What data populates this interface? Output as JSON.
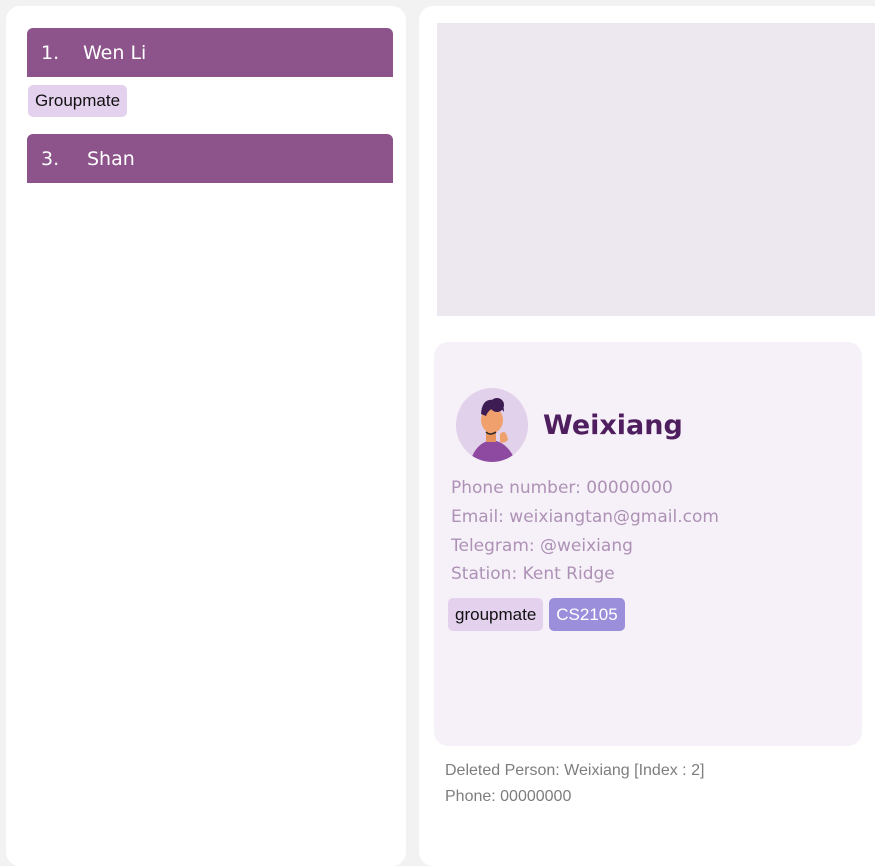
{
  "person_list": {
    "items": [
      {
        "index": "1.",
        "name": "Wen Li",
        "tag": "Groupmate"
      },
      {
        "index": "3.",
        "name": "Shan"
      }
    ]
  },
  "detail": {
    "name": "Weixiang",
    "phone": "Phone number: 00000000",
    "email": "Email: weixiangtan@gmail.com",
    "telegram": "Telegram: @weixiang",
    "station": "Station: Kent Ridge",
    "tags": [
      "groupmate",
      "CS2105"
    ],
    "avatar_icon": "avatar-person-icon"
  },
  "result": {
    "line1": "Deleted Person: Weixiang [Index : 2]",
    "line2": "Phone: 00000000"
  },
  "colors": {
    "header": "#8c548b",
    "tag_light": "#e4d1ee",
    "tag_module": "#9b8fdc",
    "name": "#4f1e5e",
    "detail_text": "#ad92b6"
  }
}
